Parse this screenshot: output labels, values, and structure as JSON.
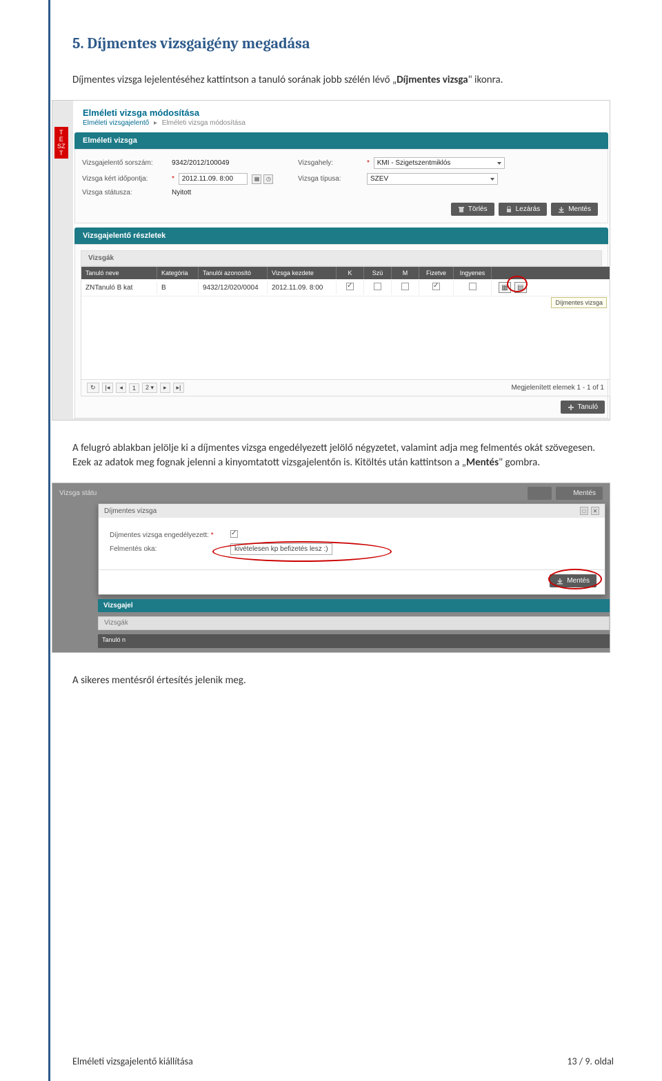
{
  "heading": "5. Díjmentes vizsgaigény megadása",
  "p1_a": "Díjmentes vizsga lejelentéséhez kattintson a tanuló sorának jobb szélén lévő „",
  "p1_b": "Díjmentes vizsga",
  "p1_c": "\" ikonra.",
  "p2_a": "A felugró ablakban jelölje ki a díjmentes vizsga engedélyezett jelölő négyzetet, valamint adja meg felmentés okát szövegesen. Ezek az adatok meg fognak jelenni a kinyomtatott vizsgajelentőn is. Kitöltés után kattintson a „",
  "p2_b": "Mentés",
  "p2_c": "\" gombra.",
  "p3": "A sikeres mentésről értesítés jelenik meg.",
  "footer_left": "Elméleti vizsgajelentő kiállítása",
  "footer_right": "13 / 9. oldal",
  "shot1": {
    "test_tag": "T\nE\nSZ\nT",
    "title": "Elméleti vizsga módosítása",
    "breadcrumb_a": "Elméleti vizsgajelentő",
    "breadcrumb_b": "Elméleti vizsga módosítása",
    "section": "Elméleti vizsga",
    "labels": {
      "sorszam": "Vizsgajelentő sorszám:",
      "idopont": "Vizsga kért időpontja:",
      "statusz": "Vizsga státusza:",
      "hely": "Vizsgahely:",
      "tipus": "Vizsga típusa:"
    },
    "values": {
      "sorszam": "9342/2012/100049",
      "idopont": "2012.11.09. 8:00",
      "statusz": "Nyitott",
      "hely": "KMI - Szigetszentmiklós",
      "tipus": "SZEV"
    },
    "btns": {
      "torles": "Törlés",
      "lezaras": "Lezárás",
      "mentes": "Mentés"
    },
    "details_bar": "Vizsgajelentő részletek",
    "subbar": "Vizsgák",
    "thead": {
      "neve": "Tanuló neve",
      "kat": "Kategória",
      "tan": "Tanulói azonosító",
      "vk": "Vizsga kezdete",
      "k": "K",
      "szu": "Szü",
      "m": "M",
      "fiz": "Fizetve",
      "ing": "Ingyenes"
    },
    "row": {
      "neve": "ZNTanuló B kat",
      "kat": "B",
      "tan": "9432/12/020/0004",
      "vk": "2012.11.09. 8:00"
    },
    "tooltip": "Díjmentes vizsga",
    "pager": {
      "page": "1",
      "size": "2",
      "info": "Megjelenített elemek 1 - 1 of 1"
    },
    "add_btn": "Tanuló"
  },
  "shot2": {
    "bg_label": "Vizsga státu",
    "modal_title": "Díjmentes vizsga",
    "lbl_enged": "Díjmentes vizsga engedélyezett:",
    "lbl_ok": "Felmentés oka:",
    "val_ok": "kivételesen kp befizetés lesz :)",
    "mentes": "Mentés",
    "bg_teal": "Vizsgajel",
    "bg_gray": "Vizsgák",
    "bg_dark": "Tanuló n"
  }
}
